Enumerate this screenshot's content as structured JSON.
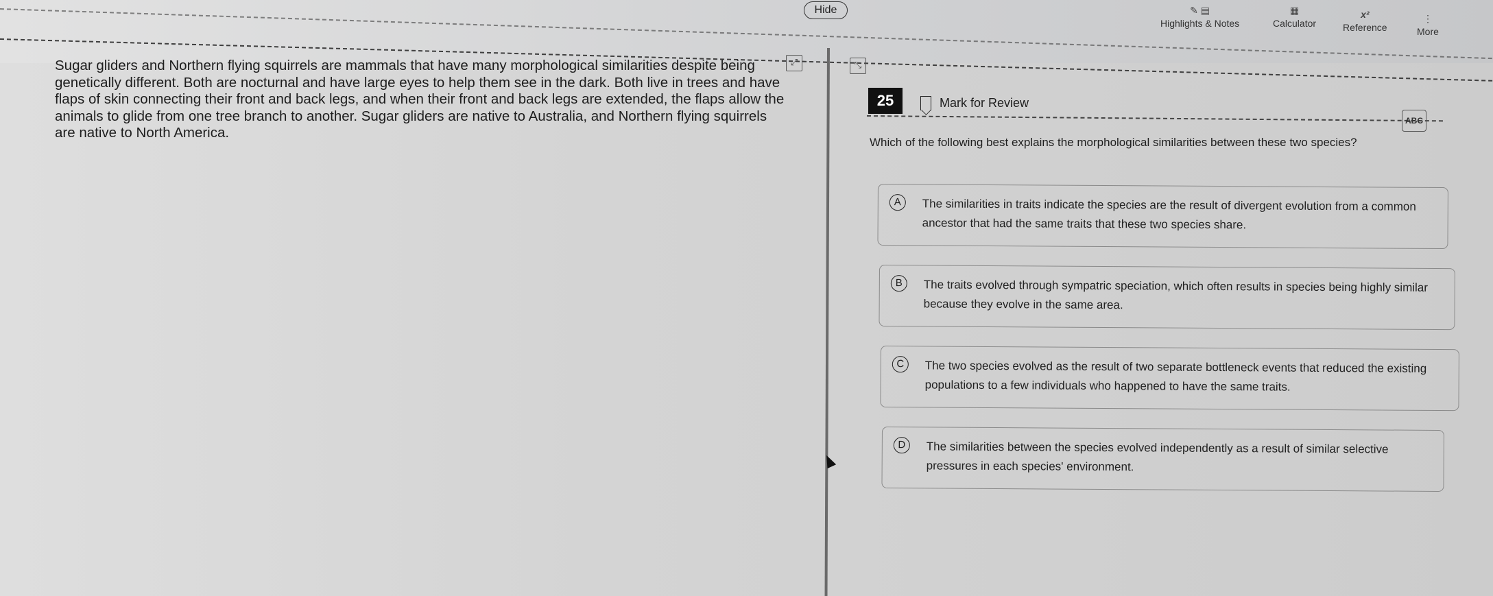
{
  "toolbar": {
    "hide_label": "Hide",
    "highlights_label": "Highlights & Notes",
    "calculator_label": "Calculator",
    "reference_label": "Reference",
    "reference_glyph": "x²",
    "more_label": "More",
    "more_glyph": "⋮"
  },
  "passage": {
    "text": "Sugar gliders and Northern flying squirrels are mammals that have many morphological similarities despite being genetically different. Both are nocturnal and have large eyes to help them see in the dark. Both live in trees and have flaps of skin connecting their front and back legs, and when their front and back legs are extended, the flaps allow the animals to glide from one tree branch to another. Sugar gliders are native to Australia, and Northern flying squirrels are native to North America."
  },
  "question": {
    "number": "25",
    "mark_label": "Mark for Review",
    "abc_label": "ABC",
    "prompt": "Which of the following best explains the morphological similarities between these two species?",
    "choices": [
      {
        "letter": "A",
        "text": "The similarities in traits indicate the species are the result of divergent evolution from a common ancestor that had the same traits that these two species share."
      },
      {
        "letter": "B",
        "text": "The traits evolved through sympatric speciation, which often results in species being highly similar because they evolve in the same area."
      },
      {
        "letter": "C",
        "text": "The two species evolved as the result of two separate bottleneck events that reduced the existing populations to a few individuals who happened to have the same traits."
      },
      {
        "letter": "D",
        "text": "The similarities between the species evolved independently as a result of similar selective pressures in each species' environment."
      }
    ]
  }
}
